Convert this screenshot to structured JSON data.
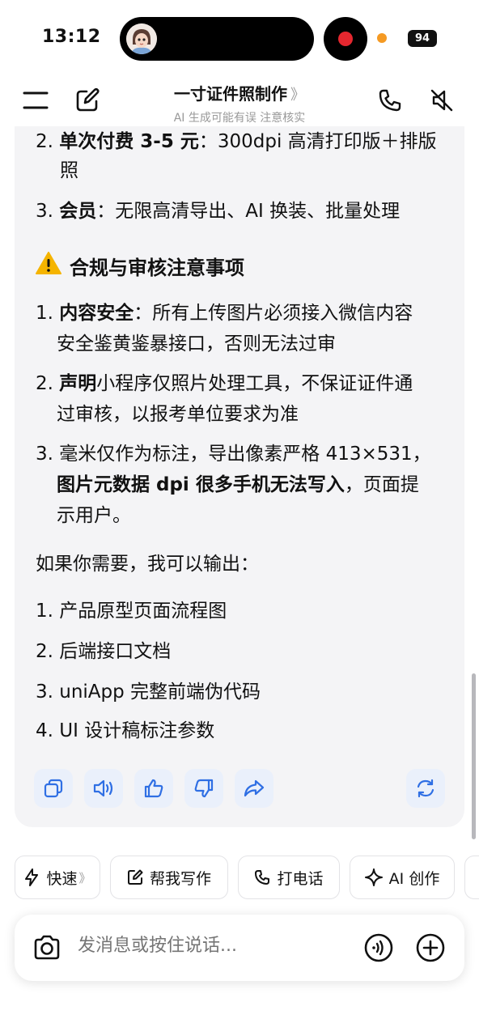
{
  "status": {
    "time": "13:12",
    "battery": "94"
  },
  "nav": {
    "title": "一寸证件照制作",
    "chevron": "》",
    "subtitle": "AI 生成可能有误 注意核实"
  },
  "content": {
    "l1_num": "2.",
    "l1_bold": "单次付费 3-5 元",
    "l1_rest": "：300dpi 高清打印版＋排版",
    "l1_cont": "照",
    "l2_num": "3.",
    "l2_bold": "会员",
    "l2_rest": "：无限高清导出、AI 换装、批量处理",
    "section_title": "合规与审核注意事项",
    "c1_num": "1.",
    "c1_bold": "内容安全",
    "c1_rest": "：所有上传图片必须接入微信内容",
    "c1_cont": "安全鉴黄鉴暴接口，否则无法过审",
    "c2_num": "2.",
    "c2_bold": "声明",
    "c2_rest": "小程序仅照片处理工具，不保证证件通",
    "c2_cont": "过审核，以报考单位要求为准",
    "c3_num": "3.",
    "c3_text": "毫米仅作为标注，导出像素严格 413×531，",
    "c3_bold": "图片元数据 dpi 很多手机无法写入",
    "c3_rest": "，页面提",
    "c3_cont": "示用户。",
    "offer": "如果你需要，我可以输出：",
    "items": [
      {
        "num": "1.",
        "text": "产品原型页面流程图"
      },
      {
        "num": "2.",
        "text": "后端接口文档"
      },
      {
        "num": "3.",
        "text": "uniApp 完整前端伪代码"
      },
      {
        "num": "4.",
        "text": "UI 设计稿标注参数"
      }
    ]
  },
  "actions": {
    "icons": [
      "copy-icon",
      "speaker-icon",
      "thumbs-up-icon",
      "thumbs-down-icon",
      "share-icon",
      "regenerate-icon"
    ]
  },
  "chips": [
    {
      "label": "快速",
      "suffix": "》",
      "icon": "lightning-icon"
    },
    {
      "label": "帮我写作",
      "icon": "edit-icon"
    },
    {
      "label": "打电话",
      "icon": "phone-icon"
    },
    {
      "label": "AI 创作",
      "icon": "sparkle-icon"
    }
  ],
  "input": {
    "placeholder": "发消息或按住说话..."
  },
  "colors": {
    "accent": "#2f6fe4",
    "card_bg": "#f4f4f6",
    "record": "#e5272f",
    "warning": "#f5b400"
  }
}
